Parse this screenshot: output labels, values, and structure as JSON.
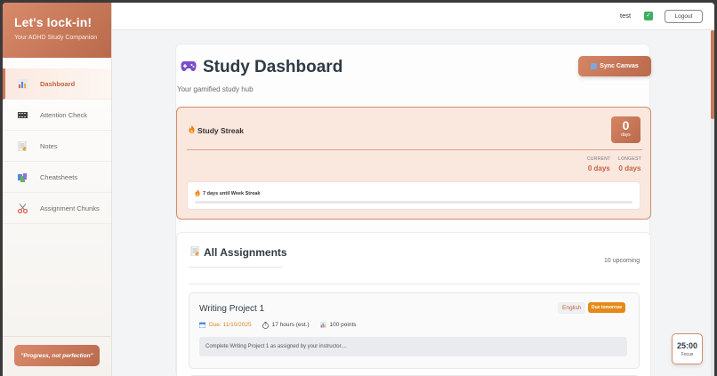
{
  "sidebar": {
    "brand_title": "Let's lock-in!",
    "brand_subtitle": "Your ADHD Study Companion",
    "items": [
      {
        "label": "Dashboard",
        "icon": "bar-chart-icon",
        "active": true
      },
      {
        "label": "Attention Check",
        "icon": "film-icon",
        "active": false
      },
      {
        "label": "Notes",
        "icon": "memo-icon",
        "active": false
      },
      {
        "label": "Cheatsheets",
        "icon": "books-icon",
        "active": false
      },
      {
        "label": "Assignment Chunks",
        "icon": "scissors-icon",
        "active": false
      }
    ],
    "quote": "\"Progress, not perfection\""
  },
  "topbar": {
    "username": "test",
    "logout_label": "Logout"
  },
  "header": {
    "title": "Study Dashboard",
    "subtitle": "Your gamified study hub",
    "sync_label": "Sync Canvas"
  },
  "streak": {
    "title": "Study Streak",
    "badge_value": "0",
    "badge_unit": "days",
    "current_label": "CURRENT",
    "current_value": "0 days",
    "longest_label": "LONGEST",
    "longest_value": "0 days",
    "progress_text": "7 days until Week Streak",
    "progress_fraction": 0
  },
  "assignments": {
    "title": "All Assignments",
    "upcoming": "10 upcoming",
    "items": [
      {
        "title": "Writing Project 1",
        "course": "English",
        "due_badge": "Due tomorrow",
        "due": "Due: 11/10/2025",
        "hours": "17 hours (est.)",
        "points": "100 points",
        "description": "Complete Writing Project 1 as assigned by your instructor...."
      }
    ]
  },
  "timer": {
    "time": "25:00",
    "label": "Focus"
  },
  "colors": {
    "accent": "#c9785a",
    "due_badge": "#e58a18",
    "check": "#3fae61"
  }
}
